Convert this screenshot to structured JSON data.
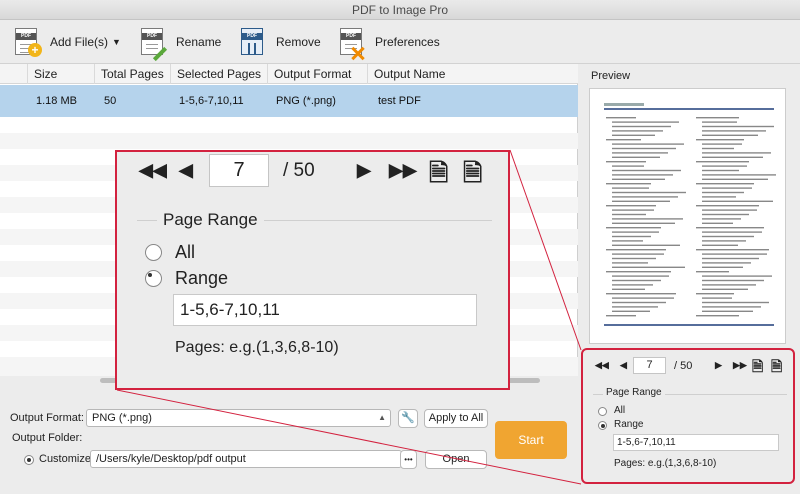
{
  "window": {
    "title": "PDF to Image Pro"
  },
  "toolbar": {
    "add_files": "Add File(s)",
    "rename": "Rename",
    "remove": "Remove",
    "preferences": "Preferences",
    "icon_label": "PDF"
  },
  "file_list": {
    "columns": [
      "Size",
      "Total Pages",
      "Selected Pages",
      "Output Format",
      "Output Name"
    ],
    "rows": [
      {
        "size": "1.18 MB",
        "total_pages": "50",
        "selected_pages": "1-5,6-7,10,11",
        "output_format": "PNG (*.png)",
        "output_name": "test PDF"
      }
    ]
  },
  "settings": {
    "output_format_label": "Output Format:",
    "output_format_value": "PNG (*.png)",
    "apply_to_all": "Apply to All",
    "output_folder_label": "Output Folder:",
    "customize_label": "Customize:",
    "folder_path": "/Users/kyle/Desktop/pdf output",
    "browse": "•••",
    "open": "Open",
    "start": "Start"
  },
  "preview": {
    "title": "Preview",
    "current_page": "7",
    "total_pages": "/ 50",
    "page_range_title": "Page Range",
    "option_all": "All",
    "option_range": "Range",
    "range_value": "1-5,6-7,10,11",
    "pages_hint": "Pages: e.g.(1,3,6,8-10)",
    "selected_option": "Range"
  },
  "colors": {
    "accent_red": "#d3223f",
    "start_orange": "#f0a531",
    "selection_blue": "#b5d3ec"
  }
}
